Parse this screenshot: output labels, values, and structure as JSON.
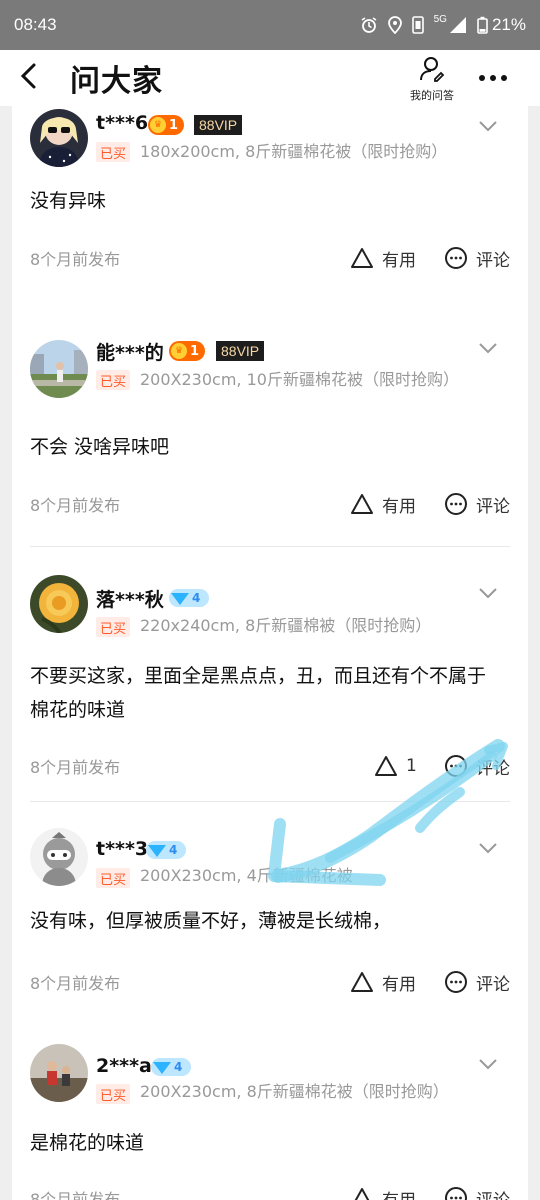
{
  "status_bar": {
    "time": "08:43",
    "network": "5G",
    "battery": "21%"
  },
  "header": {
    "title": "问大家",
    "my_qa_label": "我的问答"
  },
  "items": [
    {
      "user": "t***6",
      "badge_type": "level",
      "level": "1",
      "vip": "88VIP",
      "bought": "已买",
      "sku": "180x200cm, 8斤新疆棉花被（限时抢购）",
      "answer": "没有异味",
      "time": "8个月前发布",
      "useful": "有用",
      "comment": "评论"
    },
    {
      "user": "能***的",
      "badge_type": "level",
      "level": "1",
      "vip": "88VIP",
      "bought": "已买",
      "sku": "200X230cm, 10斤新疆棉花被（限时抢购）",
      "answer": "不会 没啥异味吧",
      "time": "8个月前发布",
      "useful": "有用",
      "comment": "评论"
    },
    {
      "user": "落***秋",
      "badge_type": "diamond",
      "level": "4",
      "bought": "已买",
      "sku": "220x240cm, 8斤新疆棉被（限时抢购）",
      "answer": "不要买这家，里面全是黑点点，丑，而且还有个不属于棉花的味道",
      "time": "8个月前发布",
      "useful": "1",
      "comment": "评论"
    },
    {
      "user": "t***3",
      "badge_type": "diamond",
      "level": "4",
      "bought": "已买",
      "sku": "200X230cm, 4斤新疆棉花被",
      "answer": "没有味，但厚被质量不好，薄被是长绒棉，",
      "time": "8个月前发布",
      "useful": "有用",
      "comment": "评论"
    },
    {
      "user": "2***a",
      "badge_type": "diamond",
      "level": "4",
      "bought": "已买",
      "sku": "200X230cm, 8斤新疆棉花被（限时抢购）",
      "answer": "是棉花的味道",
      "time": "8个月前发布",
      "useful": "有用",
      "comment": "评论"
    }
  ],
  "colors": {
    "accent": "#ff5a2a",
    "level_badge": "#ff6a00",
    "vip_badge": "#1d1d1d",
    "diamond_badge": "#bde6ff",
    "muted_text": "#999999",
    "scribble": "#7fd4f0"
  },
  "icons": {
    "back": "chevron-left-icon",
    "my_qa": "person-edit-icon",
    "more": "more-dots-icon",
    "useful": "triangle-outline-icon",
    "comment": "chat-bubble-icon",
    "expand": "chevron-down-icon"
  }
}
